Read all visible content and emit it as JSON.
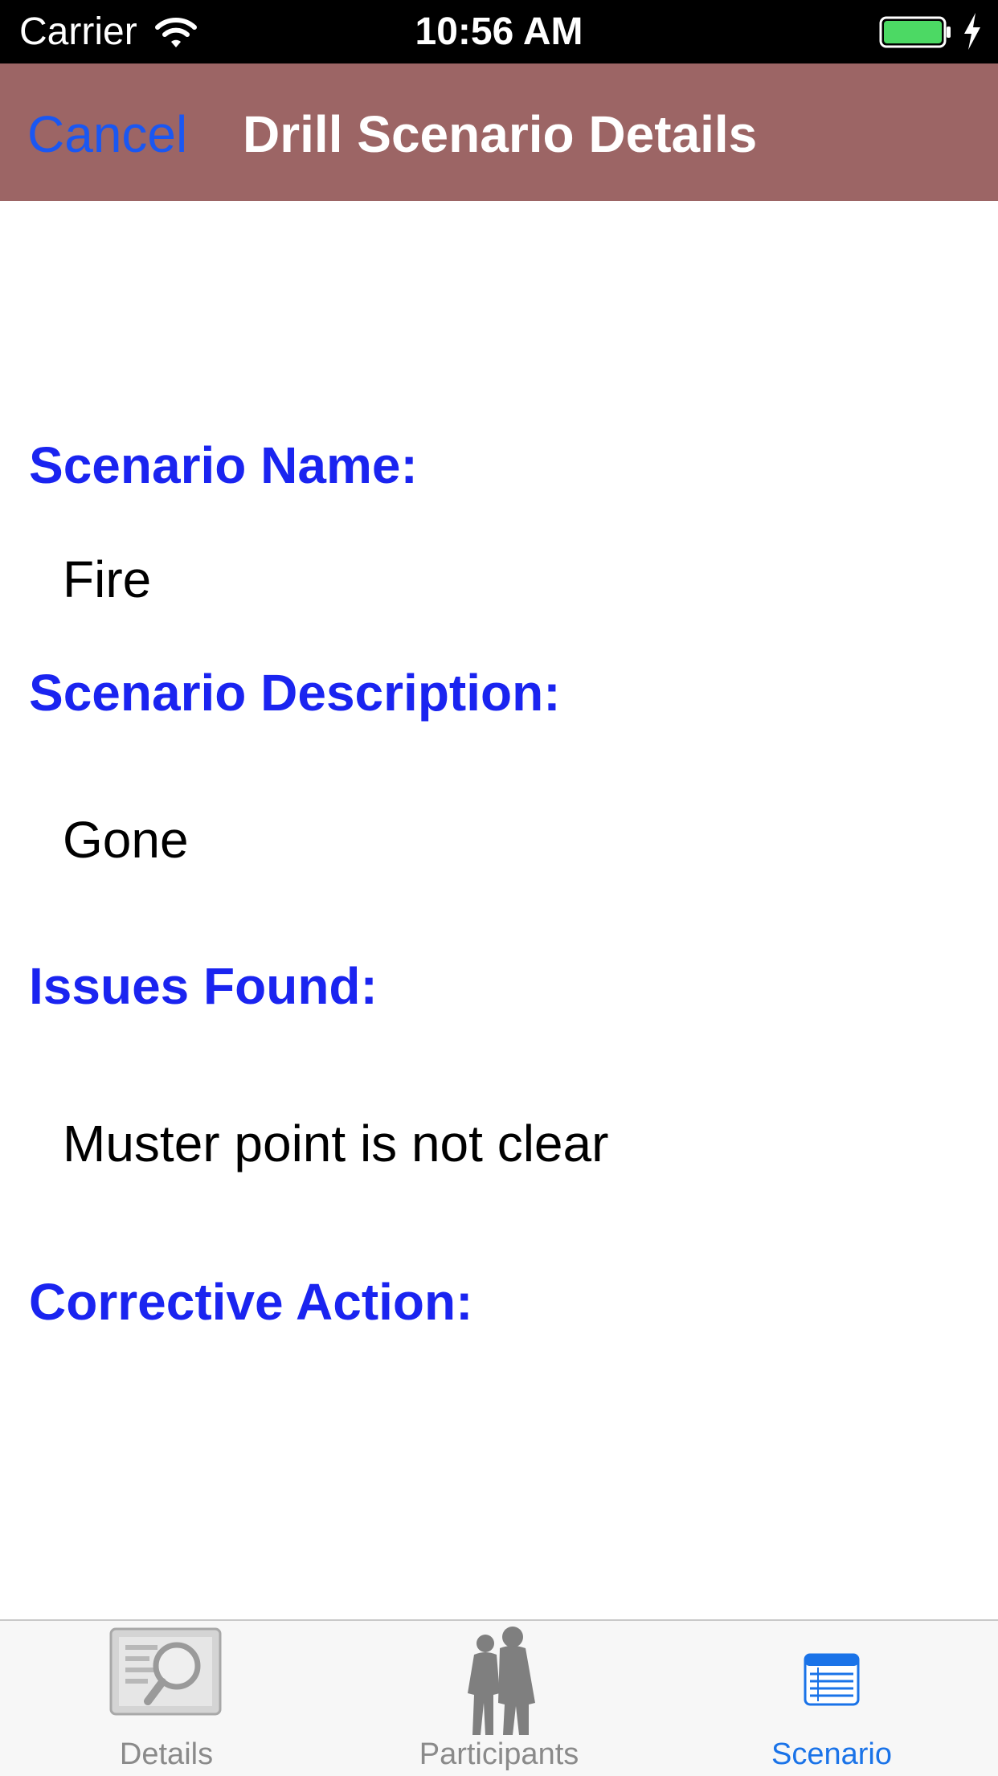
{
  "status_bar": {
    "carrier": "Carrier",
    "time": "10:56 AM",
    "icons": [
      "wifi-icon",
      "battery-icon",
      "charging-bolt-icon"
    ],
    "battery_color": "#4cd964"
  },
  "nav_bar": {
    "cancel_label": "Cancel",
    "title": "Drill Scenario Details",
    "background_color": "#9c6565"
  },
  "content": {
    "scenario_name_label": "Scenario Name:",
    "scenario_name_value": "Fire",
    "scenario_description_label": "Scenario Description:",
    "scenario_description_value": "Gone",
    "issues_found_label": "Issues Found:",
    "issues_found_value": "Muster point is not clear",
    "corrective_action_label": "Corrective Action:",
    "corrective_action_value": "",
    "label_color": "#1a24f0"
  },
  "tab_bar": {
    "tabs": [
      {
        "label": "Details",
        "icon": "magnifier-document-icon",
        "active": false
      },
      {
        "label": "Participants",
        "icon": "people-silhouette-icon",
        "active": false
      },
      {
        "label": "Scenario",
        "icon": "list-icon",
        "active": true
      }
    ],
    "active_color": "#1a73e8"
  }
}
